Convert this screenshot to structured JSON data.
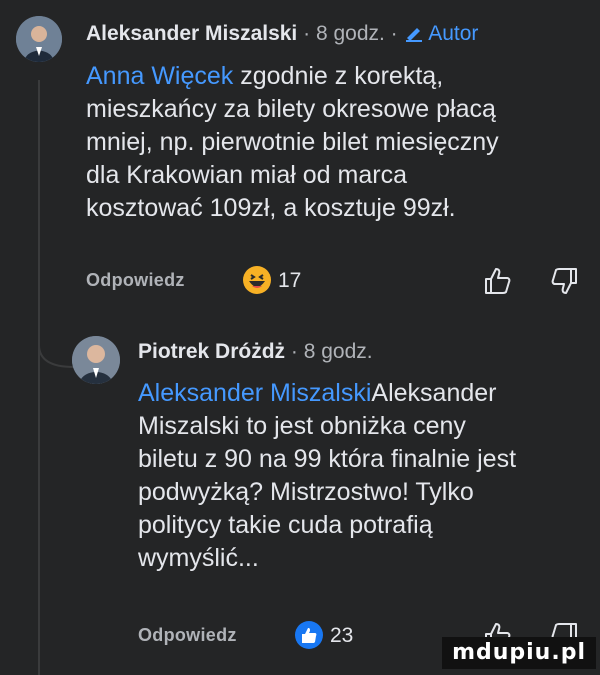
{
  "comment1": {
    "author": "Aleksander Miszalski",
    "time": "· 8 godz. ·",
    "badge_label": "Autor",
    "mention": "Anna Więcek",
    "lines": [
      " zgodnie z korektą,",
      "mieszkańcy za bilety okresowe płacą",
      "mniej, np. pierwotnie bilet miesięczny",
      "dla Krakowian miał od marca",
      "kosztować 109zł, a kosztuje 99zł."
    ],
    "reply_label": "Odpowiedz",
    "reaction_count": "17",
    "reaction_type": "haha",
    "colors": {
      "reaction": "#f7b125"
    }
  },
  "comment2": {
    "author": "Piotrek Dróżdż",
    "time": "· 8 godz.",
    "mention": "Aleksander Miszalski",
    "lines": [
      "Aleksander",
      "Miszalski to jest obniżka ceny",
      "biletu z 90 na 99 która finalnie jest",
      "podwyżką? Mistrzostwo! Tylko",
      "politycy takie cuda potrafią",
      "wymyślić..."
    ],
    "reply_label": "Odpowiedz",
    "reaction_count": "23",
    "reaction_type": "like",
    "colors": {
      "reaction": "#1877f2"
    }
  },
  "watermark": "mdupiu.pl",
  "colors": {
    "background": "#242526",
    "text": "#e4e6eb",
    "meta": "#b0b3b8",
    "link": "#4599ff"
  }
}
